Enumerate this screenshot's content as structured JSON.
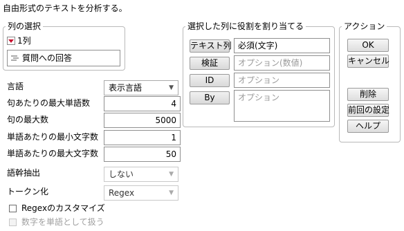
{
  "header": {
    "title": "自由形式のテキストを分析する。"
  },
  "column_select": {
    "title": "列の選択",
    "count_label": "1列",
    "items": [
      {
        "label": "質問への回答"
      }
    ]
  },
  "roles": {
    "title": "選択した列に役割を割り当てる",
    "rows": [
      {
        "button": "テキスト列",
        "value": "必須(文字)",
        "placeholder": false
      },
      {
        "button": "検証",
        "value": "オプション(数値)",
        "placeholder": true
      },
      {
        "button": "ID",
        "value": "オプション",
        "placeholder": true
      },
      {
        "button": "By",
        "value": "オプション",
        "placeholder": true
      }
    ]
  },
  "actions": {
    "title": "アクション",
    "ok": "OK",
    "cancel": "キャンセル",
    "remove": "削除",
    "recall": "前回の設定",
    "help": "ヘルプ"
  },
  "options": {
    "language": {
      "label": "言語",
      "value": "表示言語"
    },
    "max_words_per_phrase": {
      "label": "句あたりの最大単語数",
      "value": "4"
    },
    "max_phrases": {
      "label": "句の最大数",
      "value": "5000"
    },
    "min_chars_per_word": {
      "label": "単語あたりの最小文字数",
      "value": "1"
    },
    "max_chars_per_word": {
      "label": "単語あたりの最大文字数",
      "value": "50"
    },
    "stemming": {
      "label": "語幹抽出",
      "value": "しない"
    },
    "tokenizing": {
      "label": "トークン化",
      "value": "Regex"
    },
    "customize_regex": {
      "label": "Regexのカスタマイズ",
      "checked": false
    },
    "treat_numbers": {
      "label": "数字を単語として扱う",
      "checked": false,
      "disabled": true
    }
  },
  "colors": {
    "accent_red": "#c8102e",
    "border": "#b9b9b9",
    "disabled": "#a0a0a0"
  }
}
